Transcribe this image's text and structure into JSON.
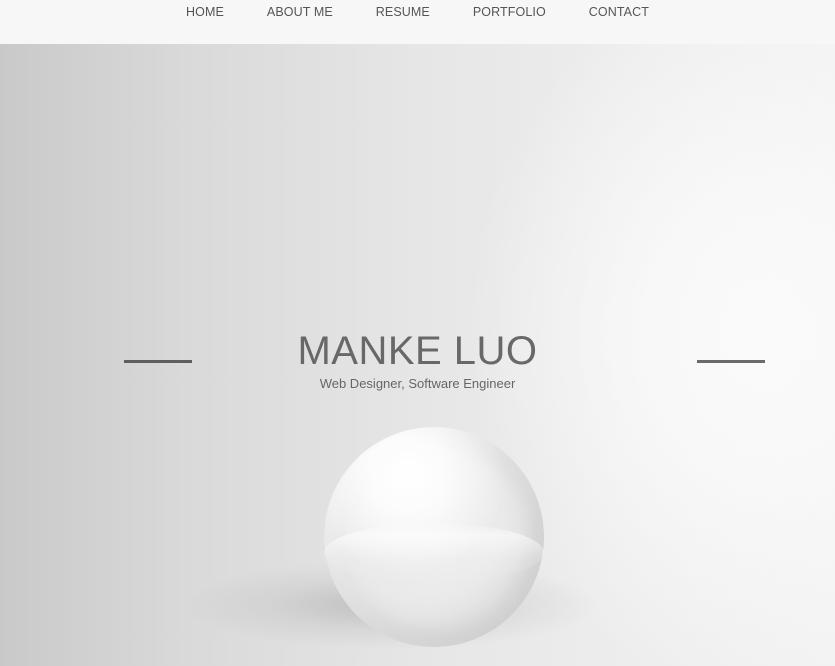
{
  "nav": {
    "items": [
      {
        "label": "HOME"
      },
      {
        "label": "ABOUT ME"
      },
      {
        "label": "RESUME"
      },
      {
        "label": "PORTFOLIO"
      },
      {
        "label": "CONTACT"
      }
    ]
  },
  "hero": {
    "name": "MANKE LUO",
    "tagline": "Web Designer, Software Engineer"
  },
  "colors": {
    "nav_background": "#f7f7f7",
    "nav_text": "#555555",
    "title_text": "#686868",
    "accent_dash": "#5e5e5e"
  }
}
